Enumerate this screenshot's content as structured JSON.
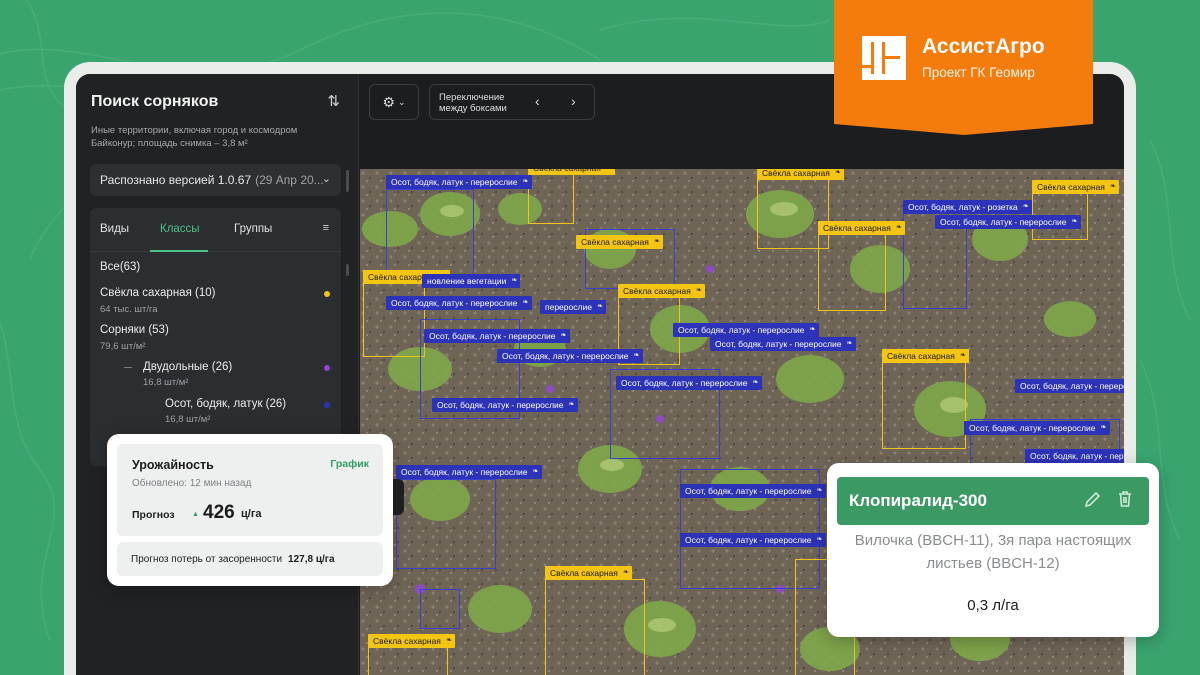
{
  "brand": {
    "name": "АссистАгро",
    "subtitle": "Проект ГК Геомир",
    "color": "#f47c0d"
  },
  "sidebar": {
    "title": "Поиск сорняков",
    "description": "Иные территории, включая город и космодром Байконур; площадь снимка – 3,8 м²",
    "version_label": "Распознано версией 1.0.67",
    "version_date": "(29 Апр 20...",
    "tabs": [
      {
        "label": "Виды"
      },
      {
        "label": "Классы"
      },
      {
        "label": "Группы"
      }
    ],
    "active_tab": "Классы",
    "classes": {
      "all": "Все(63)",
      "beet": {
        "label": "Свёкла сахарная (10)",
        "sub": "64 тыс. шт/га",
        "color": "#f0c419"
      },
      "weeds": {
        "label": "Сорняки (53)",
        "sub": "79,6 шт/м²"
      },
      "dicots": {
        "label": "Двудольные (26)",
        "sub": "16,8 шт/м²",
        "color": "#9b3fd6"
      },
      "thistle": {
        "label": "Осот, бодяк, латук (26)",
        "sub": "16,8 шт/м²",
        "color": "#2d33b8"
      }
    }
  },
  "toolbar": {
    "switch_label": "Переключение между боксами",
    "prev": "‹",
    "next": "›"
  },
  "field": {
    "labels": {
      "beet": "Свёкла сахарная",
      "thistle_overgrown": "Осот, бодяк, латук - перерослие",
      "thistle_rosette": "Осот, бодяк, латук - розетка",
      "regrowth": "новление вегетации",
      "overgrown_short": "перерослие"
    },
    "prev_btn": "‹",
    "next_btn": "›"
  },
  "yield_card": {
    "title": "Урожайность",
    "link": "График",
    "updated": "Обновлено: 12 мин назад",
    "forecast_label": "Прогноз",
    "forecast_value": "426",
    "forecast_unit": "ц/га",
    "loss_label": "Прогноз потерь от засоренности",
    "loss_value": "127,8 ц/га"
  },
  "herbicide_card": {
    "name": "Клопиралид-300",
    "stage": "Вилочка (BBCH-11), 3я пара настоящих листьев (BBCH-12)",
    "dose": "0,3 л/га",
    "accent": "#3b9a63"
  }
}
